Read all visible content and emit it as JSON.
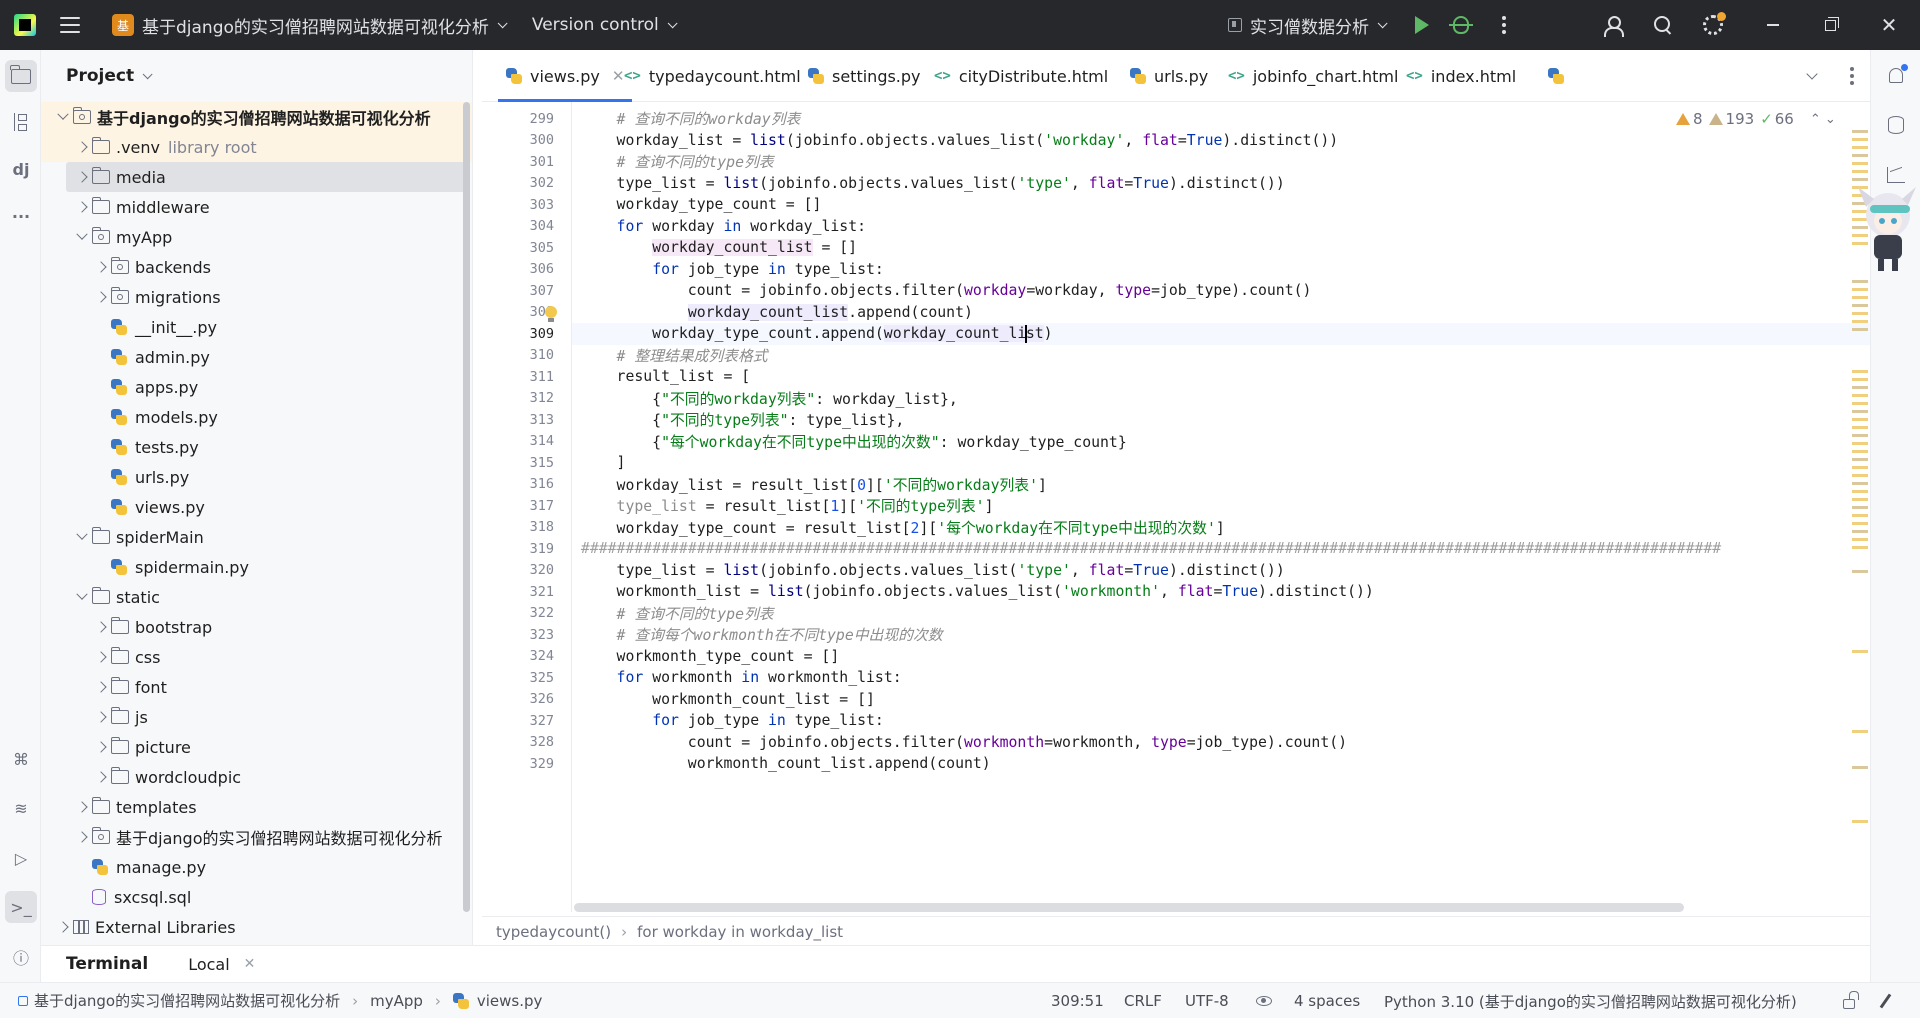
{
  "titlebar": {
    "badge": "基",
    "project_name": "基于django的实习僧招聘网站数据可视化分析",
    "vcs_label": "Version control",
    "run_config": "实习僧数据分析"
  },
  "project_panel": {
    "title": "Project",
    "tree": [
      {
        "label": "基于django的实习僧招聘网站数据可视化分析",
        "type": "root",
        "indent": 0,
        "arrow": "down"
      },
      {
        "label": ".venv",
        "suffix": "library root",
        "type": "folder",
        "indent": 1,
        "arrow": "right"
      },
      {
        "label": "media",
        "type": "folder",
        "indent": 1,
        "arrow": "right"
      },
      {
        "label": "middleware",
        "type": "folder",
        "indent": 1,
        "arrow": "right"
      },
      {
        "label": "myApp",
        "type": "pkg",
        "indent": 1,
        "arrow": "down"
      },
      {
        "label": "backends",
        "type": "pkg",
        "indent": 2,
        "arrow": "right"
      },
      {
        "label": "migrations",
        "type": "pkg",
        "indent": 2,
        "arrow": "right"
      },
      {
        "label": "__init__.py",
        "type": "py",
        "indent": 2
      },
      {
        "label": "admin.py",
        "type": "py",
        "indent": 2
      },
      {
        "label": "apps.py",
        "type": "py",
        "indent": 2
      },
      {
        "label": "models.py",
        "type": "py",
        "indent": 2
      },
      {
        "label": "tests.py",
        "type": "py",
        "indent": 2
      },
      {
        "label": "urls.py",
        "type": "py",
        "indent": 2
      },
      {
        "label": "views.py",
        "type": "py",
        "indent": 2
      },
      {
        "label": "spiderMain",
        "type": "folder",
        "indent": 1,
        "arrow": "down"
      },
      {
        "label": "spidermain.py",
        "type": "py",
        "indent": 2
      },
      {
        "label": "static",
        "type": "folder",
        "indent": 1,
        "arrow": "down"
      },
      {
        "label": "bootstrap",
        "type": "folder",
        "indent": 2,
        "arrow": "right"
      },
      {
        "label": "css",
        "type": "folder",
        "indent": 2,
        "arrow": "right"
      },
      {
        "label": "font",
        "type": "folder",
        "indent": 2,
        "arrow": "right"
      },
      {
        "label": "js",
        "type": "folder",
        "indent": 2,
        "arrow": "right"
      },
      {
        "label": "picture",
        "type": "folder",
        "indent": 2,
        "arrow": "right"
      },
      {
        "label": "wordcloudpic",
        "type": "folder",
        "indent": 2,
        "arrow": "right"
      },
      {
        "label": "templates",
        "type": "folder",
        "indent": 1,
        "arrow": "right"
      },
      {
        "label": "基于django的实习僧招聘网站数据可视化分析",
        "type": "pkg",
        "indent": 1,
        "arrow": "right"
      },
      {
        "label": "manage.py",
        "type": "py",
        "indent": 1
      },
      {
        "label": "sxcsql.sql",
        "type": "sql",
        "indent": 1
      },
      {
        "label": "External Libraries",
        "type": "lib",
        "indent": 0,
        "arrow": "right"
      }
    ]
  },
  "tabs": [
    {
      "label": "views.py",
      "icon": "python-icon",
      "active": true
    },
    {
      "label": "typedaycount.html",
      "icon": "html-icon"
    },
    {
      "label": "settings.py",
      "icon": "python-icon"
    },
    {
      "label": "cityDistribute.html",
      "icon": "html-icon"
    },
    {
      "label": "urls.py",
      "icon": "python-icon"
    },
    {
      "label": "jobinfo_chart.html",
      "icon": "html-icon"
    },
    {
      "label": "index.html",
      "icon": "html-icon"
    }
  ],
  "inspections": {
    "warnings": "8",
    "weak_warnings": "193",
    "ok": "66"
  },
  "code_lines": [
    {
      "n": "299",
      "html": "    <span class=\"cm\"># 查询不同的workday列表</span>"
    },
    {
      "n": "300",
      "html": "    workday_list = <span class=\"fn\">list</span>(jobinfo.objects.values_list(<span class=\"str\">'workday'</span>, <span class=\"prm\">flat</span>=<span class=\"kw\">True</span>).distinct())"
    },
    {
      "n": "301",
      "html": "    <span class=\"cm\"># 查询不同的type列表</span>"
    },
    {
      "n": "302",
      "html": "    type_list = <span class=\"fn\">list</span>(jobinfo.objects.values_list(<span class=\"str\">'type'</span>, <span class=\"prm\">flat</span>=<span class=\"kw\">True</span>).distinct())"
    },
    {
      "n": "303",
      "html": "    workday_type_count = []"
    },
    {
      "n": "304",
      "html": "    <span class=\"kw\">for</span> workday <span class=\"kw\">in</span> workday_list:"
    },
    {
      "n": "305",
      "html": "        <span class=\"hlvar2\">workday_count_list</span> = []"
    },
    {
      "n": "306",
      "html": "        <span class=\"kw\">for</span> job_type <span class=\"kw\">in</span> type_list:"
    },
    {
      "n": "307",
      "html": "            count = jobinfo.objects.filter(<span class=\"prm\">workday</span>=workday, <span class=\"prm\">type</span>=job_type).count()"
    },
    {
      "n": "308",
      "html": "            <span class=\"hlvar\">workday_count_list</span>.append(count)",
      "bulb": true
    },
    {
      "n": "309",
      "html": "        workday_type_count.append(<span class=\"hlvar\">workday_count_li<span class=\"caret\"></span>st</span>)",
      "current": true
    },
    {
      "n": "310",
      "html": "    <span class=\"cm\"># 整理结果成列表格式</span>"
    },
    {
      "n": "311",
      "html": "    result_list = ["
    },
    {
      "n": "312",
      "html": "        {<span class=\"str\">\"不同的workday列表\"</span>: workday_list},"
    },
    {
      "n": "313",
      "html": "        {<span class=\"str\">\"不同的type列表\"</span>: type_list},"
    },
    {
      "n": "314",
      "html": "        {<span class=\"str\">\"每个workday在不同type中出现的次数\"</span>: workday_type_count}"
    },
    {
      "n": "315",
      "html": "    ]"
    },
    {
      "n": "316",
      "html": "    workday_list = result_list[<span class=\"num\">0</span>][<span class=\"str\">'不同的workday列表'</span>]"
    },
    {
      "n": "317",
      "html": "    <span class=\"grey\">type_list</span> = result_list[<span class=\"num\">1</span>][<span class=\"str\">'不同的type列表'</span>]"
    },
    {
      "n": "318",
      "html": "    workday_type_count = result_list[<span class=\"num\">2</span>][<span class=\"str\">'每个workday在不同type中出现的次数'</span>]"
    },
    {
      "n": "319",
      "html": "<span class=\"hsep\">################################################################################################################################</span>"
    },
    {
      "n": "320",
      "html": "    type_list = <span class=\"fn\">list</span>(jobinfo.objects.values_list(<span class=\"str\">'type'</span>, <span class=\"prm\">flat</span>=<span class=\"kw\">True</span>).distinct())"
    },
    {
      "n": "321",
      "html": "    workmonth_list = <span class=\"fn\">list</span>(jobinfo.objects.values_list(<span class=\"str\">'workmonth'</span>, <span class=\"prm\">flat</span>=<span class=\"kw\">True</span>).distinct())"
    },
    {
      "n": "322",
      "html": "    <span class=\"cm\"># 查询不同的type列表</span>"
    },
    {
      "n": "323",
      "html": "    <span class=\"cm\"># 查询每个workmonth在不同type中出现的次数</span>"
    },
    {
      "n": "324",
      "html": "    workmonth_type_count = []"
    },
    {
      "n": "325",
      "html": "    <span class=\"kw\">for</span> workmonth <span class=\"kw\">in</span> workmonth_list:"
    },
    {
      "n": "326",
      "html": "        workmonth_count_list = []"
    },
    {
      "n": "327",
      "html": "        <span class=\"kw\">for</span> job_type <span class=\"kw\">in</span> type_list:"
    },
    {
      "n": "328",
      "html": "            count = jobinfo.objects.filter(<span class=\"prm\">workmonth</span>=workmonth, <span class=\"prm\">type</span>=job_type).count()"
    },
    {
      "n": "329",
      "html": "            workmonth_count_list.append(count)"
    }
  ],
  "breadcrumbs": [
    "typedaycount()",
    "for workday in workday_list"
  ],
  "terminal": {
    "title": "Terminal",
    "tab": "Local"
  },
  "statusbar": {
    "path": [
      "基于django的实习僧招聘网站数据可视化分析",
      "myApp",
      "views.py"
    ],
    "position": "309:51",
    "line_sep": "CRLF",
    "encoding": "UTF-8",
    "indent": "4 spaces",
    "interpreter": "Python 3.10 (基于django的实习僧招聘网站数据可视化分析)"
  }
}
